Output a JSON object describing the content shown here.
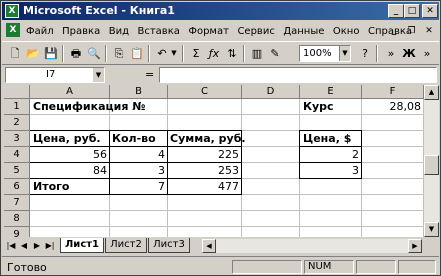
{
  "window": {
    "title": "Microsoft Excel - Книга1",
    "app_icon": "excel-icon",
    "controls": [
      "minimize",
      "maximize",
      "close"
    ]
  },
  "menu": {
    "items": [
      "Файл",
      "Правка",
      "Вид",
      "Вставка",
      "Формат",
      "Сервис",
      "Данные",
      "Окно",
      "Справка"
    ]
  },
  "toolbar": {
    "zoom": "100%",
    "icons": [
      "new-icon",
      "open-icon",
      "save-icon",
      "print-icon",
      "preview-icon",
      "copy-icon",
      "paste-icon",
      "undo-icon",
      "autosum-icon",
      "function-icon",
      "sort-icon",
      "chart-icon",
      "bold-icon"
    ]
  },
  "formula_bar": {
    "name_box": "I7",
    "equals": "=",
    "formula": ""
  },
  "sheet": {
    "columns": [
      "A",
      "B",
      "C",
      "D",
      "E",
      "F"
    ],
    "rows": [
      "1",
      "2",
      "3",
      "4",
      "5",
      "6",
      "7",
      "8",
      "9"
    ],
    "cells": {
      "A1": "Спецификация №",
      "E1": "Курс",
      "F1": "28,08",
      "A3": "Цена, руб.",
      "B3": "Кол-во",
      "C3": "Сумма, руб.",
      "E3": "Цена, $",
      "A4": "56",
      "B4": "4",
      "C4": "225",
      "E4": "2",
      "A5": "84",
      "B5": "3",
      "C5": "253",
      "E5": "3",
      "A6": "Итого",
      "B6": "7",
      "C6": "477"
    }
  },
  "tabs": {
    "items": [
      "Лист1",
      "Лист2",
      "Лист3"
    ],
    "active": "Лист1"
  },
  "status": {
    "text": "Готово",
    "num": "NUM"
  },
  "colors": {
    "title_bar": "#0a246a",
    "chrome": "#d4d0c8"
  }
}
